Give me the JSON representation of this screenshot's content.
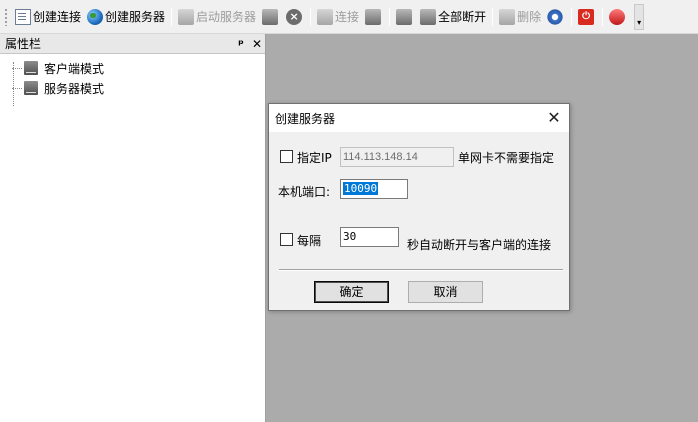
{
  "toolbar": {
    "create_connection": "创建连接",
    "create_server": "创建服务器",
    "start_server": "启动服务器",
    "connect": "连接",
    "disconnect_all": "全部断开",
    "delete": "删除"
  },
  "panel": {
    "title": "属性栏",
    "pin_glyph": "ᵖ",
    "close_glyph": "✕",
    "items": [
      {
        "label": "客户端模式"
      },
      {
        "label": "服务器模式"
      }
    ]
  },
  "dialog": {
    "title": "创建服务器",
    "close_glyph": "✕",
    "specify_ip_label": "指定IP",
    "ip_value": "114.113.148.14",
    "ip_hint": "单网卡不需要指定",
    "port_label": "本机端口:",
    "port_value": "10090",
    "every_label": "每隔",
    "interval_value": "30",
    "interval_suffix": "秒自动断开与客户端的连接",
    "ok_label": "确定",
    "cancel_label": "取消"
  },
  "colors": {
    "workspace": "#ababab",
    "selection": "#0078d7"
  }
}
